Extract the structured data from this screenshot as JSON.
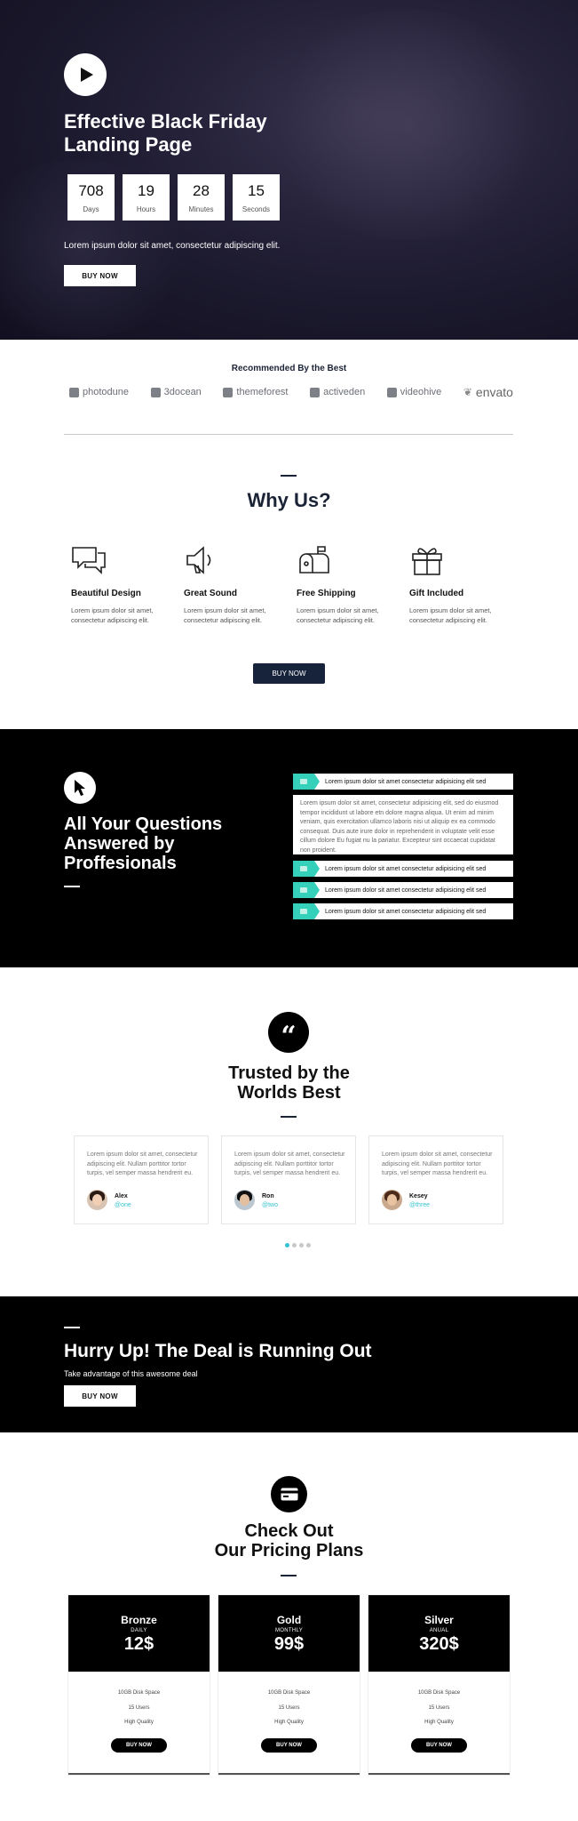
{
  "hero": {
    "title": "Effective Black Friday Landing Page",
    "countdown": [
      {
        "value": "708",
        "label": "Days"
      },
      {
        "value": "19",
        "label": "Hours"
      },
      {
        "value": "28",
        "label": "Minutes"
      },
      {
        "value": "15",
        "label": "Seconds"
      }
    ],
    "subtitle": "Lorem ipsum dolor sit amet, consectetur adipiscing elit.",
    "button": "BUY NOW",
    "play_icon": "play-icon"
  },
  "recommended": {
    "title": "Recommended By the Best",
    "logos": [
      "photodune",
      "3docean",
      "themeforest",
      "activeden",
      "videohive",
      "envato"
    ]
  },
  "why_us": {
    "title": "Why Us?",
    "features": [
      {
        "icon": "chat-bubbles-icon",
        "title": "Beautiful Design",
        "text": "Lorem ipsum dolor sit amet, consectetur adipiscing elit."
      },
      {
        "icon": "speaker-icon",
        "title": "Great Sound",
        "text": "Lorem ipsum dolor sit amet, consectetur adipiscing elit."
      },
      {
        "icon": "mailbox-icon",
        "title": "Free Shipping",
        "text": "Lorem ipsum dolor sit amet, consectetur adipiscing elit."
      },
      {
        "icon": "gift-icon",
        "title": "Gift Included",
        "text": "Lorem ipsum dolor sit amet, consectetur adipiscing elit."
      }
    ],
    "button": "BUY NOW"
  },
  "faq": {
    "title": "All Your Questions Answered by Proffesionals",
    "items": [
      {
        "label": "Lorem ipsum dolor sit amet consectetur adipisicing elit sed",
        "expanded": true
      },
      {
        "label": "Lorem ipsum dolor sit amet consectetur adipisicing elit sed",
        "expanded": false
      },
      {
        "label": "Lorem ipsum dolor sit amet consectetur adipisicing elit sed",
        "expanded": false
      },
      {
        "label": "Lorem ipsum dolor sit amet consectetur adipisicing elit sed",
        "expanded": false
      }
    ],
    "body": "Lorem ipsum dolor sit amet, consectetur adipisicing elit, sed do eiusmod tempor incididunt ut labore etn dolore magna aliqua. Ut enim ad minim veniam, quis exercitation ullamco laboris nisi ut aliquip ex ea commodo consequat. Duis aute irure dolor in reprehenderit in voluptate velit esse cillum dolore Eu fugiat nu la pariatur. Excepteur sint occaecat cupidatat non proident."
  },
  "testimonials": {
    "title": "Trusted by the Worlds Best",
    "items": [
      {
        "text": "Lorem ipsum dolor sit amet, consectetur adipiscing elit. Nullam porttitor tortor turpis, vel semper massa hendrerit eu.",
        "name": "Alex",
        "handle": "@one"
      },
      {
        "text": "Lorem ipsum dolor sit amet, consectetur adipiscing elit. Nullam porttitor tortor turpis, vel semper massa hendrerit eu.",
        "name": "Ron",
        "handle": "@two"
      },
      {
        "text": "Lorem ipsum dolor sit amet, consectetur adipiscing elit. Nullam porttitor tortor turpis, vel semper massa hendrerit eu.",
        "name": "Kesey",
        "handle": "@three"
      }
    ],
    "active_dot": 0,
    "dot_count": 4
  },
  "hurry": {
    "title": "Hurry Up! The Deal is Running Out",
    "subtitle": "Take advantage of this awesome deal",
    "button": "BUY NOW"
  },
  "pricing": {
    "title_line1": "Check Out",
    "title_line2": "Our Pricing Plans",
    "plans": [
      {
        "name": "Bronze",
        "period": "DAILY",
        "price": "12$",
        "features": [
          "10GB Disk Space",
          "15 Users",
          "High Quality"
        ],
        "button": "BUY NOW"
      },
      {
        "name": "Gold",
        "period": "MONTHLY",
        "price": "99$",
        "features": [
          "10GB Disk Space",
          "15 Users",
          "High Quality"
        ],
        "button": "BUY NOW"
      },
      {
        "name": "Silver",
        "period": "ANUAL",
        "price": "320$",
        "features": [
          "10GB Disk Space",
          "15 Users",
          "High Quality"
        ],
        "button": "BUY NOW"
      }
    ]
  },
  "colors": {
    "accent_teal": "#35d0ba",
    "navy": "#17233b",
    "black": "#000000"
  }
}
